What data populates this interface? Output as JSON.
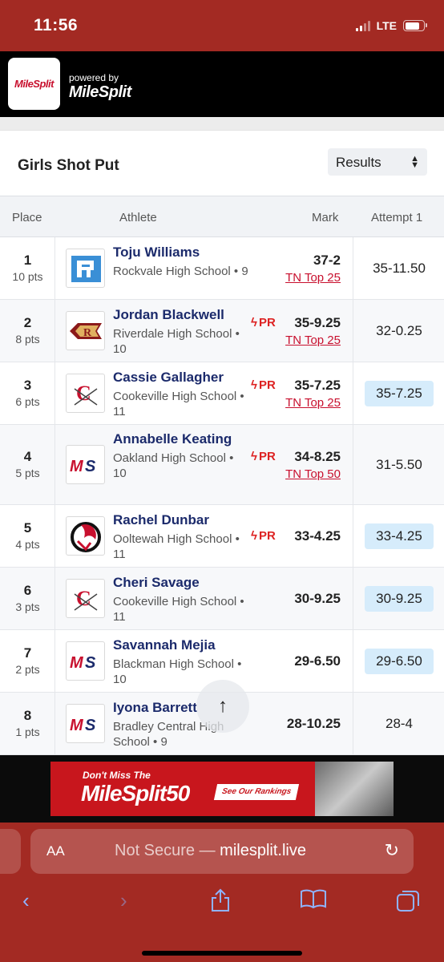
{
  "status_bar": {
    "time": "11:56",
    "network": "LTE"
  },
  "header": {
    "logo_text": "MileSplit",
    "powered_by": "powered by",
    "brand": "MileSplit"
  },
  "event": {
    "title": "Girls Shot Put",
    "view_select": "Results"
  },
  "table": {
    "columns": {
      "place": "Place",
      "athlete": "Athlete",
      "mark": "Mark",
      "attempt": "Attempt 1"
    },
    "rows": [
      {
        "place": "1",
        "pts": "10 pts",
        "name": "Toju Williams",
        "school": "Rockvale High School • 9",
        "pr": "",
        "mark": "37-2",
        "rank": "TN Top 25",
        "attempt": "35-11.50",
        "highlight": false,
        "logo": "rockvale-r"
      },
      {
        "place": "2",
        "pts": "8 pts",
        "name": "Jordan Blackwell",
        "school": "Riverdale High School • 10",
        "pr": "PR",
        "mark": "35-9.25",
        "rank": "TN Top 25",
        "attempt": "32-0.25",
        "highlight": false,
        "logo": "riverdale-arrowhead"
      },
      {
        "place": "3",
        "pts": "6 pts",
        "name": "Cassie Gallagher",
        "school": "Cookeville High School • 11",
        "pr": "PR",
        "mark": "35-7.25",
        "rank": "TN Top 25",
        "attempt": "35-7.25",
        "highlight": true,
        "logo": "cookeville-c"
      },
      {
        "place": "4",
        "pts": "5 pts",
        "name": "Annabelle Keating",
        "school": "Oakland High School • 10",
        "pr": "PR",
        "mark": "34-8.25",
        "rank": "TN Top 50",
        "attempt": "31-5.50",
        "highlight": false,
        "logo": "ms"
      },
      {
        "place": "5",
        "pts": "4 pts",
        "name": "Rachel Dunbar",
        "school": "Ooltewah High School • 11",
        "pr": "PR",
        "mark": "33-4.25",
        "rank": "",
        "attempt": "33-4.25",
        "highlight": true,
        "logo": "ooltewah-owl"
      },
      {
        "place": "6",
        "pts": "3 pts",
        "name": "Cheri Savage",
        "school": "Cookeville High School • 11",
        "pr": "",
        "mark": "30-9.25",
        "rank": "",
        "attempt": "30-9.25",
        "highlight": true,
        "logo": "cookeville-c"
      },
      {
        "place": "7",
        "pts": "2 pts",
        "name": "Savannah Mejia",
        "school": "Blackman High School • 10",
        "pr": "",
        "mark": "29-6.50",
        "rank": "",
        "attempt": "29-6.50",
        "highlight": true,
        "logo": "ms"
      },
      {
        "place": "8",
        "pts": "1 pts",
        "name": "Iyona Barrett",
        "school": "Bradley Central High School • 9",
        "pr": "",
        "mark": "28-10.25",
        "rank": "",
        "attempt": "28-4",
        "highlight": false,
        "logo": "ms"
      }
    ]
  },
  "ad": {
    "line1": "Don't Miss The",
    "line2": "MileSplit50",
    "button": "See Our Rankings"
  },
  "browser": {
    "aa": "AA",
    "not_secure": "Not Secure —",
    "domain": "milesplit.live"
  },
  "colors": {
    "browser_chrome": "#a32a23",
    "brand_red": "#c8102e",
    "athlete_name": "#1b2a6b",
    "highlight": "#d6ecfb"
  }
}
